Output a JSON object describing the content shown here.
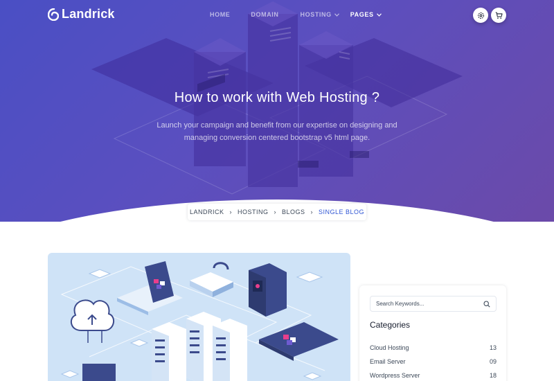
{
  "brand": {
    "name": "Landrick"
  },
  "nav": {
    "items": [
      {
        "label": "HOME",
        "dropdown": false,
        "active": false
      },
      {
        "label": "DOMAIN",
        "dropdown": false,
        "active": false
      },
      {
        "label": "HOSTING",
        "dropdown": true,
        "active": false
      },
      {
        "label": "PAGES",
        "dropdown": true,
        "active": true
      }
    ],
    "buttons": [
      {
        "icon": "settings-icon"
      },
      {
        "icon": "shopping-cart-icon"
      }
    ]
  },
  "hero": {
    "title": "How to work with Web Hosting ?",
    "subtitle": "Launch your campaign and benefit from our expertise on designing and managing conversion centered bootstrap v5 html page."
  },
  "breadcrumb": {
    "items": [
      "LANDRICK",
      "HOSTING",
      "BLOGS"
    ],
    "current": "SINGLE BLOG"
  },
  "sidebar": {
    "search": {
      "placeholder": "Search Keywords..."
    },
    "categories_title": "Categories",
    "categories": [
      {
        "name": "Cloud Hosting",
        "count": "13"
      },
      {
        "name": "Email Server",
        "count": "09"
      },
      {
        "name": "Wordpress Server",
        "count": "18"
      }
    ]
  },
  "colors": {
    "hero_gradient_start": "#4a4fc4",
    "hero_gradient_end": "#6b4aa9",
    "accent": "#2f55d4",
    "text": "#3c4858"
  }
}
